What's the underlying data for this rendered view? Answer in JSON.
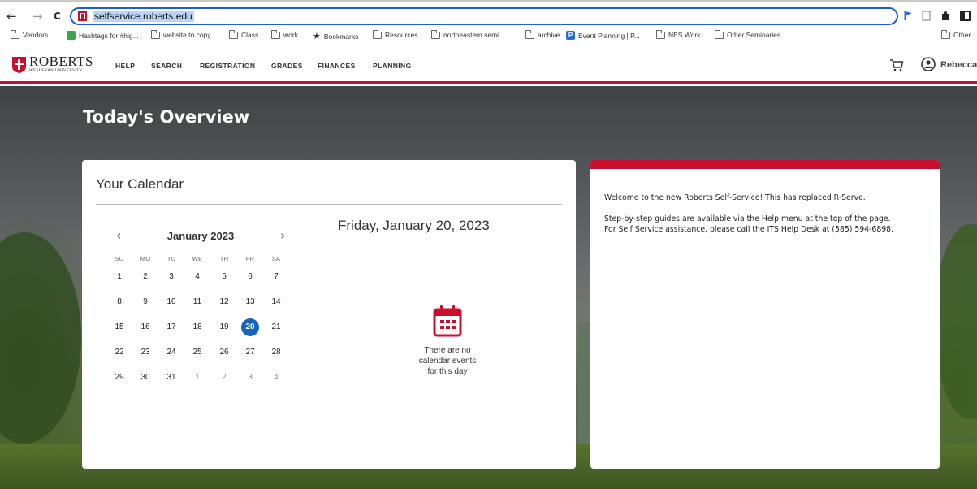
{
  "browser": {
    "back_icon": "←",
    "forward_icon": "→",
    "reload_icon": "C",
    "url": "selfservice.roberts.edu",
    "bookmarks": [
      {
        "label": "Vendors",
        "icon": "folder-icon"
      },
      {
        "label": "Hashtags for #hig...",
        "icon": "green-app-icon"
      },
      {
        "label": "website to copy",
        "icon": "folder-icon"
      },
      {
        "label": "Class",
        "icon": "folder-icon"
      },
      {
        "label": "work",
        "icon": "folder-icon"
      },
      {
        "label": "Bookmarks",
        "icon": "star-icon"
      },
      {
        "label": "Resources",
        "icon": "folder-icon"
      },
      {
        "label": "northeastern semi...",
        "icon": "folder-icon"
      },
      {
        "label": "archive",
        "icon": "folder-icon"
      },
      {
        "label": "Event Planning | P...",
        "icon": "p-badge-icon"
      },
      {
        "label": "NES Work",
        "icon": "folder-icon"
      },
      {
        "label": "Other Seminaries",
        "icon": "folder-icon"
      },
      {
        "label": "Other",
        "icon": "folder-icon"
      }
    ]
  },
  "header": {
    "logo_main": "ROBERTS",
    "logo_sub": "WESLEYAN UNIVERSITY",
    "nav": [
      "HELP",
      "SEARCH",
      "REGISTRATION",
      "GRADES",
      "FINANCES",
      "PLANNING"
    ],
    "user_name": "Rebecca",
    "accent_color": "#c8102e"
  },
  "page_title": "Today's Overview",
  "calendar": {
    "title": "Your Calendar",
    "month_label": "January 2023",
    "prev": "‹",
    "next": "›",
    "days_of_week": [
      "SU",
      "MO",
      "TU",
      "WE",
      "TH",
      "FR",
      "SA"
    ],
    "weeks": [
      [
        "1",
        "2",
        "3",
        "4",
        "5",
        "6",
        "7"
      ],
      [
        "8",
        "9",
        "10",
        "11",
        "12",
        "13",
        "14"
      ],
      [
        "15",
        "16",
        "17",
        "18",
        "19",
        "20",
        "21"
      ],
      [
        "22",
        "23",
        "24",
        "25",
        "26",
        "27",
        "28"
      ],
      [
        "29",
        "30",
        "31",
        "1",
        "2",
        "3",
        "4"
      ]
    ],
    "selected_day": "20",
    "selected_color": "#1565c0",
    "date_heading": "Friday, January 20, 2023",
    "no_events_line1": "There are no",
    "no_events_line2": "calendar events",
    "no_events_line3": "for this day"
  },
  "welcome": {
    "line1": "Welcome to the new Roberts Self-Service! This has replaced R-Serve.",
    "line2": "Step-by-step guides are available via the Help menu at the top of the page.",
    "line3": "For Self Service assistance, please call the ITS Help Desk at (585) 594-6898."
  }
}
